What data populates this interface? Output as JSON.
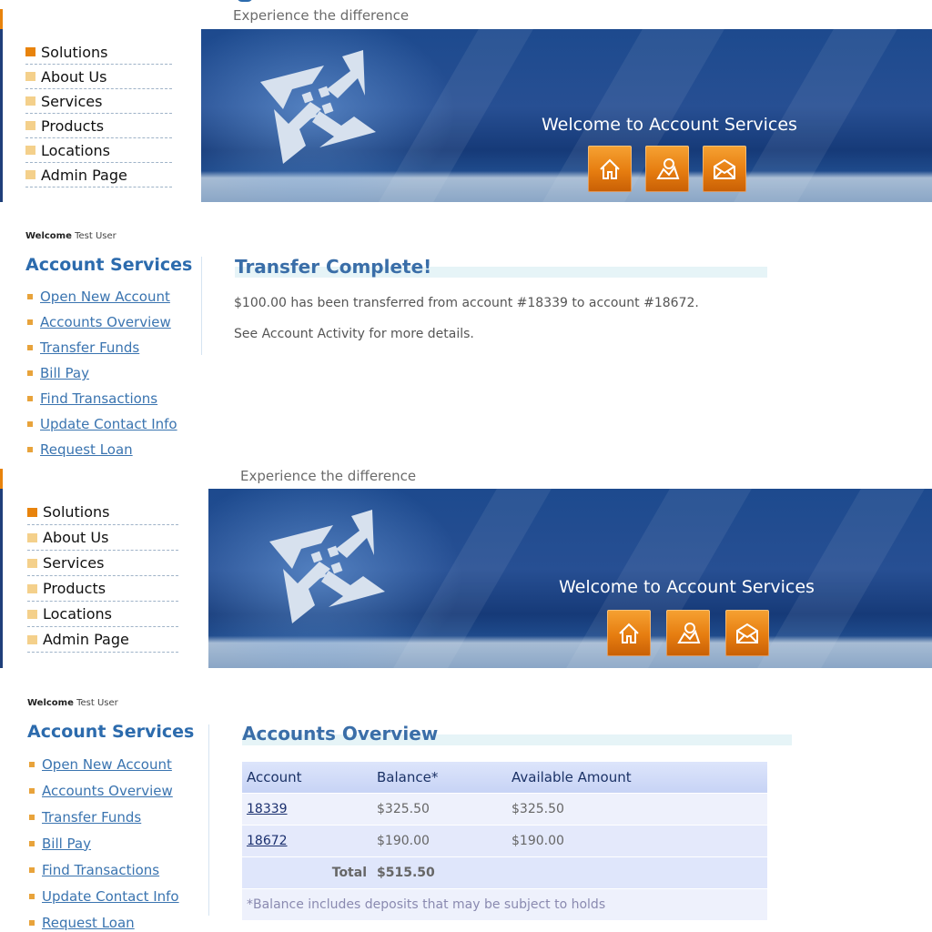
{
  "top": {
    "tagline": "Experience the difference",
    "nav": [
      "Solutions",
      "About Us",
      "Services",
      "Products",
      "Locations",
      "Admin Page"
    ],
    "banner_welcome": "Welcome to Account Services",
    "welcome_prefix": "Welcome",
    "welcome_user": "Test User",
    "account_services_heading": "Account Services",
    "account_links": [
      "Open New Account",
      "Accounts Overview",
      "Transfer Funds",
      "Bill Pay",
      "Find Transactions",
      "Update Contact Info",
      "Request Loan"
    ],
    "content_title": "Transfer Complete!",
    "transfer_message": "$100.00 has been transferred from account #18339 to account #18672.",
    "details_message": "See Account Activity for more details."
  },
  "bottom": {
    "tagline": "Experience the difference",
    "nav": [
      "Solutions",
      "About Us",
      "Services",
      "Products",
      "Locations",
      "Admin Page"
    ],
    "banner_welcome": "Welcome to Account Services",
    "welcome_prefix": "Welcome",
    "welcome_user": "Test User",
    "account_services_heading": "Account Services",
    "account_links": [
      "Open New Account",
      "Accounts Overview",
      "Transfer Funds",
      "Bill Pay",
      "Find Transactions",
      "Update Contact Info",
      "Request Loan"
    ],
    "content_title": "Accounts Overview",
    "table": {
      "headers": [
        "Account",
        "Balance*",
        "Available Amount"
      ],
      "rows": [
        {
          "account": "18339",
          "balance": "$325.50",
          "available": "$325.50"
        },
        {
          "account": "18672",
          "balance": "$190.00",
          "available": "$190.00"
        }
      ],
      "total_label": "Total",
      "total_value": "$515.50",
      "note": "*Balance includes deposits that may be subject to holds"
    }
  },
  "icons": [
    "home-icon",
    "about-icon",
    "contact-icon",
    "logo-icon"
  ],
  "colors": {
    "banner_blue": "#1d4a8e",
    "button_orange": "#e67d10",
    "link_blue": "#3a74b0",
    "heading_blue": "#2c6bad",
    "nav_active": "#e8830c",
    "nav_bullet": "#f4d08b"
  }
}
